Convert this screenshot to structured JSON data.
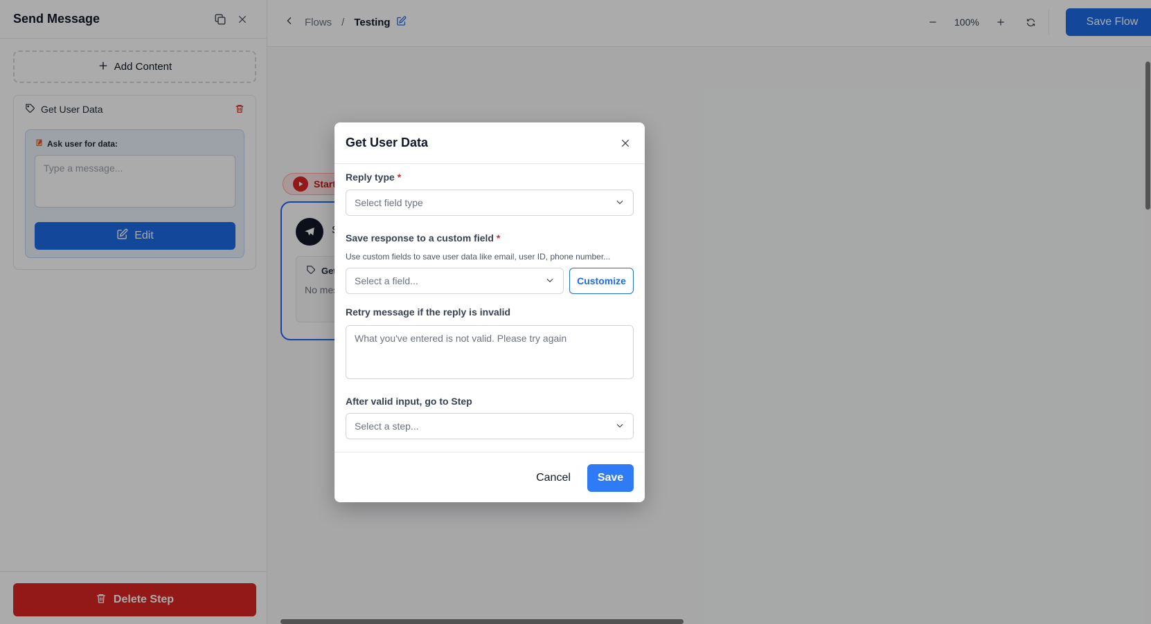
{
  "sidebar": {
    "title": "Send Message",
    "add_content_label": "Add Content",
    "card": {
      "title": "Get User Data",
      "ask_label": "Ask user for data:",
      "message_placeholder": "Type a message...",
      "edit_label": "Edit"
    },
    "delete_label": "Delete Step"
  },
  "topbar": {
    "breadcrumb_parent": "Flows",
    "breadcrumb_sep": "/",
    "breadcrumb_current": "Testing",
    "zoom_level": "100%",
    "save_flow_label": "Save Flow"
  },
  "canvas": {
    "start_label": "Start",
    "node_title_initial": "S",
    "node_inner_title": "Get",
    "node_inner_text": "No mes"
  },
  "modal": {
    "title": "Get User Data",
    "reply_type_label": "Reply type",
    "reply_type_placeholder": "Select field type",
    "custom_field_label": "Save response to a custom field",
    "custom_field_help": "Use custom fields to save user data like email, user ID, phone number...",
    "custom_field_placeholder": "Select a field...",
    "customize_label": "Customize",
    "retry_label": "Retry message if the reply is invalid",
    "retry_placeholder": "What you've entered is not valid. Please try again",
    "next_step_label": "After valid input, go to Step",
    "next_step_placeholder": "Select a step...",
    "required_mark": "*",
    "cancel_label": "Cancel",
    "save_label": "Save"
  },
  "colors": {
    "primary": "#1d6ae5",
    "danger": "#dc2626",
    "overlay": "rgba(0,0,0,0.33)"
  }
}
